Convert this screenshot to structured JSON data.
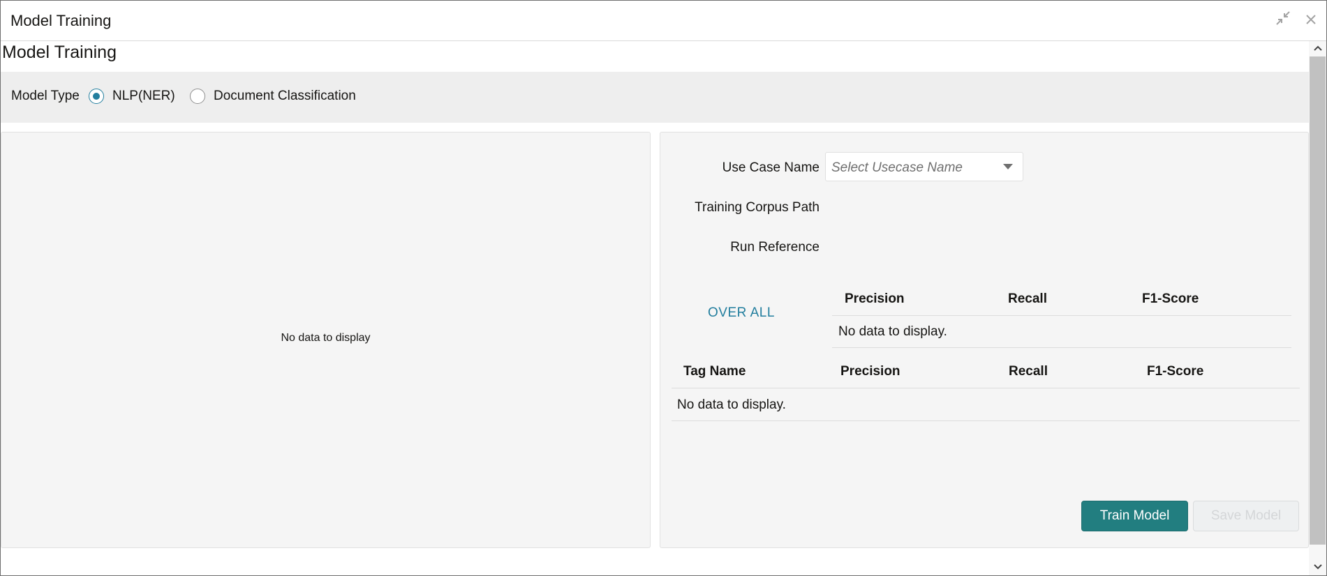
{
  "window": {
    "title": "Model Training",
    "collapse_icon": "collapse-arrows-icon",
    "close_icon": "close-icon"
  },
  "page": {
    "title": "Model Training"
  },
  "model_type": {
    "label": "Model Type",
    "options": [
      {
        "label": "NLP(NER)",
        "selected": true
      },
      {
        "label": "Document Classification",
        "selected": false
      }
    ]
  },
  "left_panel": {
    "empty_text": "No data to display"
  },
  "form": {
    "use_case_label": "Use Case Name",
    "use_case_placeholder": "Select Usecase Name",
    "corpus_label": "Training Corpus Path",
    "run_reference_label": "Run Reference"
  },
  "overall_table": {
    "row_label": "OVER ALL",
    "columns": [
      "Precision",
      "Recall",
      "F1-Score"
    ],
    "empty_text": "No data to display."
  },
  "tag_table": {
    "columns": [
      "Tag Name",
      "Precision",
      "Recall",
      "F1-Score"
    ],
    "empty_text": "No data to display."
  },
  "buttons": {
    "train": "Train Model",
    "save": "Save Model"
  },
  "colors": {
    "accent": "#227e9e",
    "primary_button": "#227e80",
    "panel_bg": "#f5f5f5"
  }
}
